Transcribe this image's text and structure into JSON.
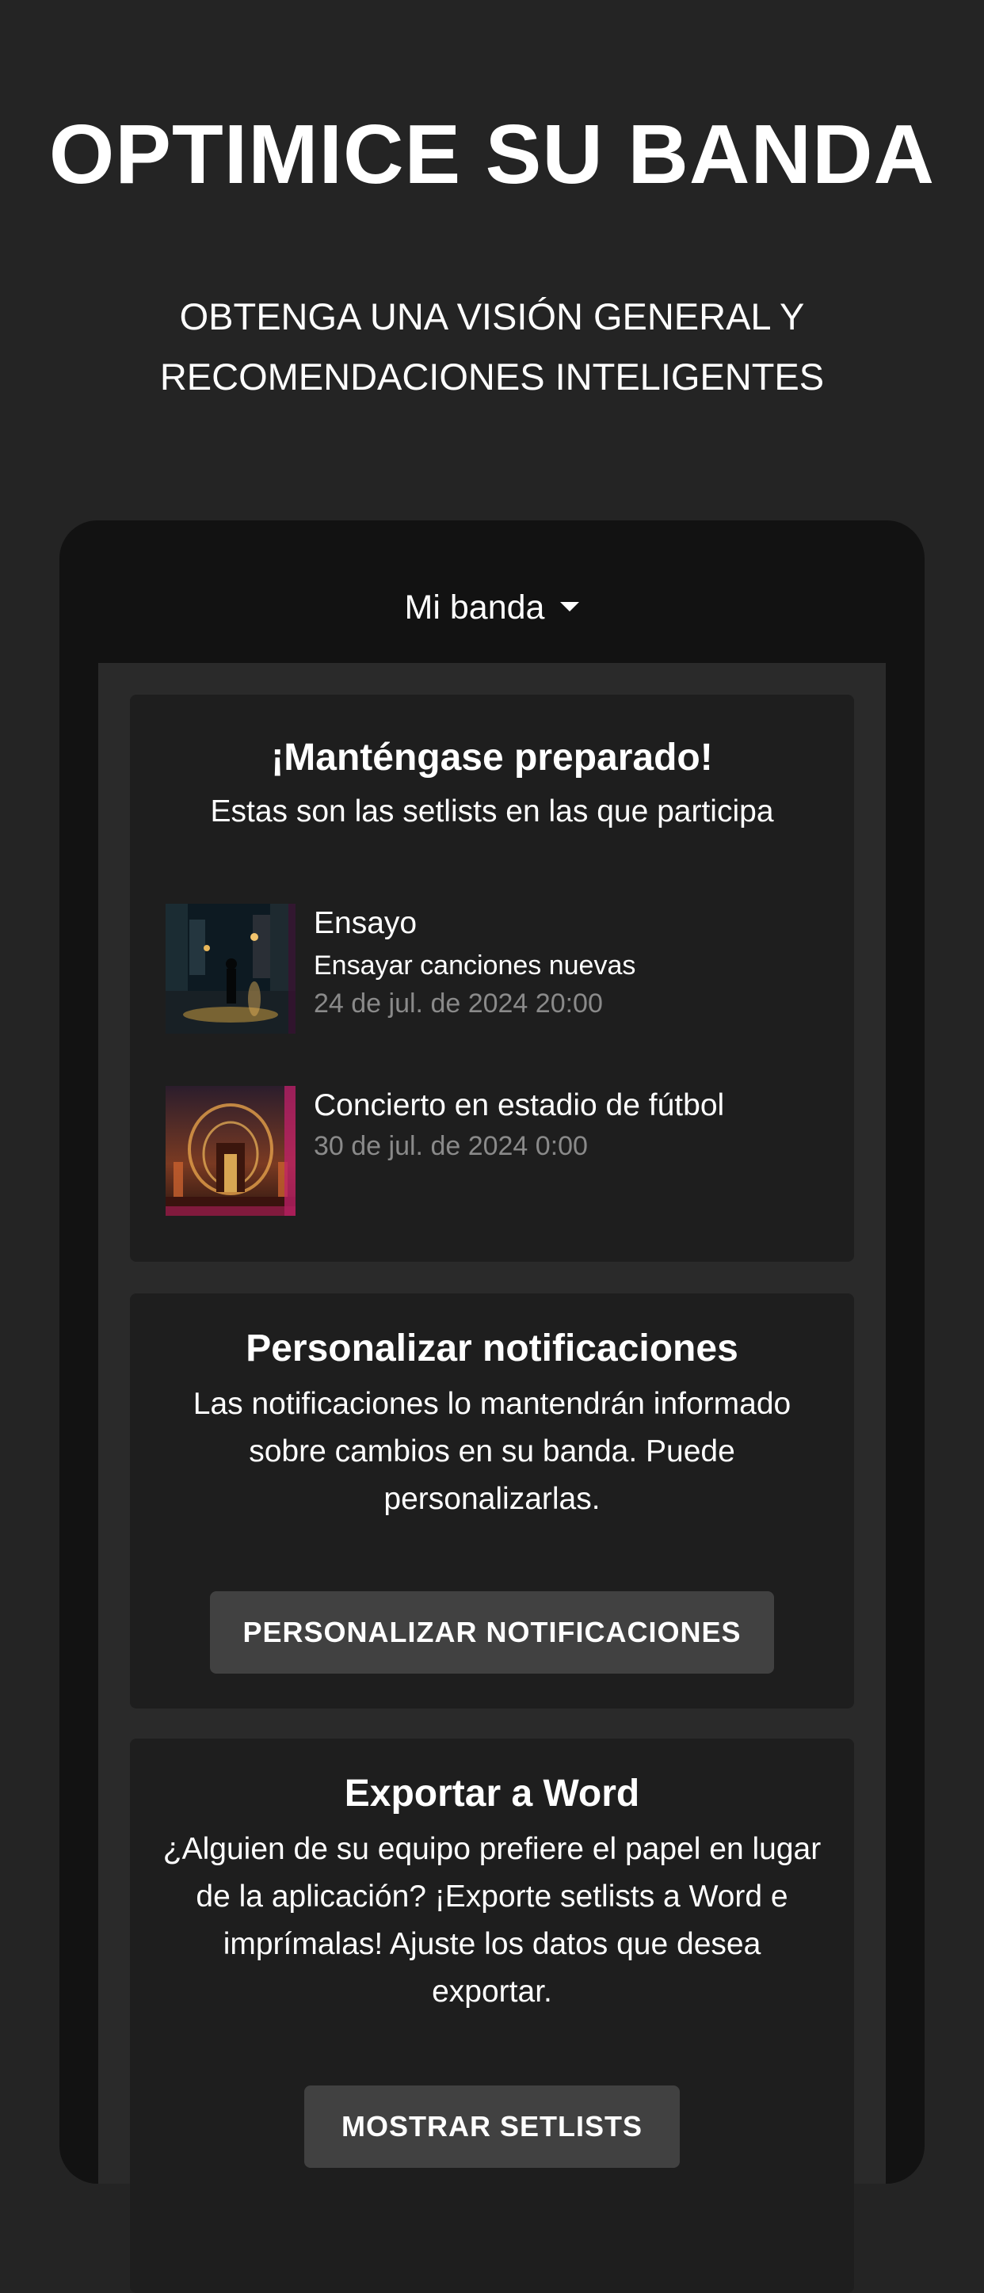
{
  "hero": {
    "title": "OPTIMICE SU BANDA",
    "subtitle_line1": "OBTENGA UNA VISIÓN GENERAL Y",
    "subtitle_line2": "RECOMENDACIONES INTELIGENTES"
  },
  "band_selector": {
    "label": "Mi banda",
    "icon": "caret-down-icon"
  },
  "prepared_card": {
    "title": "¡Manténgase preparado!",
    "subtitle": "Estas son las setlists en las que participa",
    "items": [
      {
        "name": "Ensayo",
        "description": "Ensayar canciones nuevas",
        "date": "24 de jul. de 2024 20:00"
      },
      {
        "name": "Concierto en estadio de fútbol",
        "description": "",
        "date": "30 de jul. de 2024 0:00"
      }
    ]
  },
  "notifications_card": {
    "title": "Personalizar notificaciones",
    "text": "Las notificaciones lo mantendrán informado sobre cambios en su banda. Puede personalizarlas.",
    "button_label": "PERSONALIZAR NOTIFICACIONES"
  },
  "export_card": {
    "title": "Exportar a Word",
    "text": "¿Alguien de su equipo prefiere el papel en lugar de la aplicación? ¡Exporte setlists a Word e imprímalas! Ajuste los datos que desea exportar.",
    "button_label": "MOSTRAR SETLISTS"
  },
  "colors": {
    "page_background": "#242424",
    "device_background": "#121212",
    "card_background": "#1e1e1e",
    "button_background": "#414141",
    "date_text": "#8a8a8a"
  }
}
